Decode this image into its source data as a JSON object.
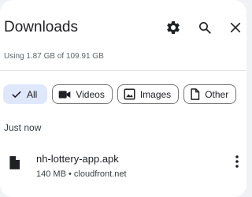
{
  "header": {
    "title": "Downloads",
    "settings_icon": "gear-icon",
    "search_icon": "search-icon",
    "close_icon": "close-icon"
  },
  "storage": {
    "text": "Using 1.87 GB of 109.91 GB"
  },
  "filters": [
    {
      "label": "All",
      "icon": "check-icon",
      "selected": true
    },
    {
      "label": "Videos",
      "icon": "video-camera-icon",
      "selected": false
    },
    {
      "label": "Images",
      "icon": "image-icon",
      "selected": false
    },
    {
      "label": "Other",
      "icon": "document-icon",
      "selected": false
    }
  ],
  "sections": [
    {
      "heading": "Just now",
      "items": [
        {
          "name": "nh-lottery-app.apk",
          "size": "140 MB",
          "separator": "•",
          "source": "cloudfront.net",
          "icon": "file-icon",
          "menu_icon": "more-vert-icon"
        }
      ]
    }
  ],
  "colors": {
    "background": "#f1f2f6",
    "panel": "#ffffff",
    "selected_chip": "#dfe7fb",
    "text_primary": "#202124",
    "text_secondary": "#5f6368"
  }
}
